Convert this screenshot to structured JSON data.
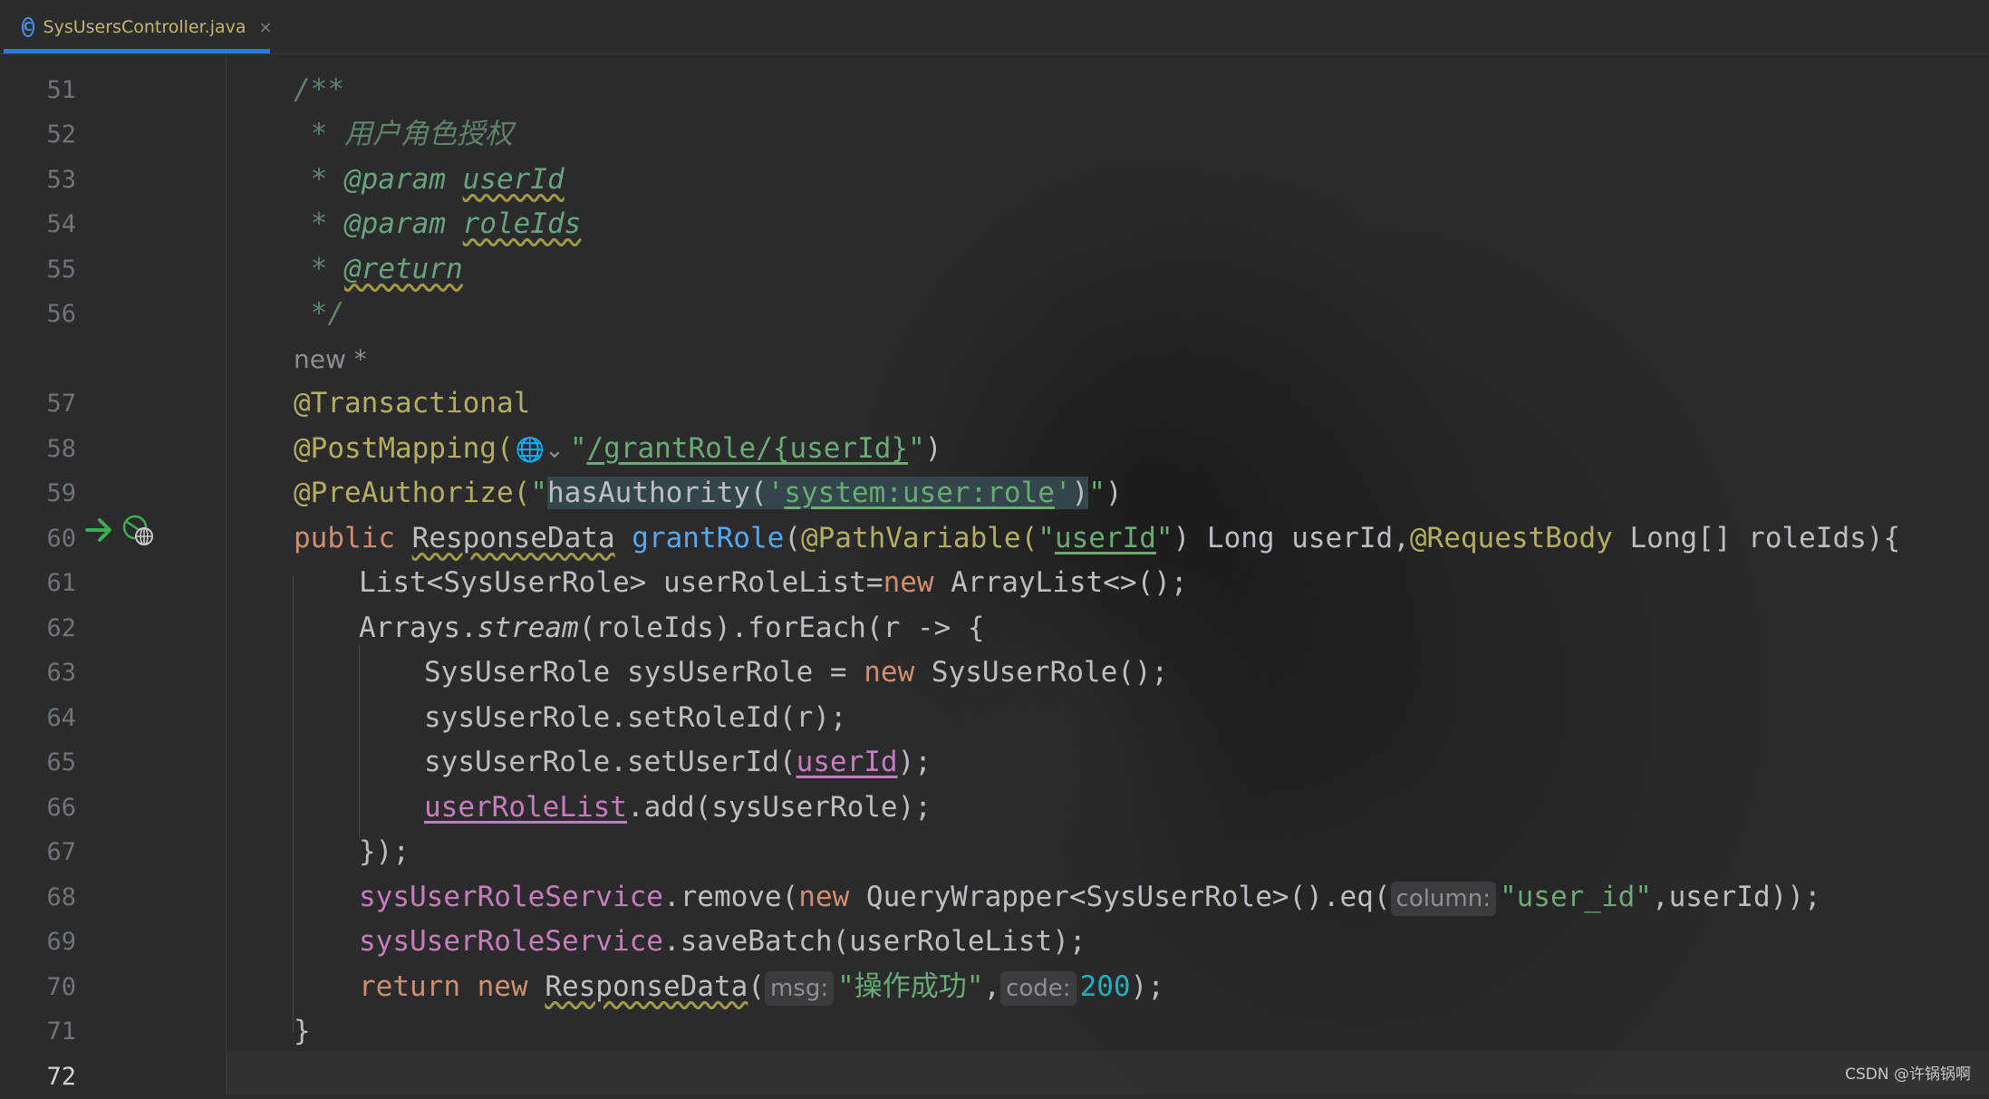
{
  "tab": {
    "icon": "class-c-icon",
    "icon_glyph": "C",
    "title": "SysUsersController.java",
    "close": "×"
  },
  "watermark": "CSDN @许锅锅啊",
  "lines": [
    {
      "n": "51"
    },
    {
      "n": "52"
    },
    {
      "n": "53"
    },
    {
      "n": "54"
    },
    {
      "n": "55"
    },
    {
      "n": "56"
    },
    {
      "n": ""
    },
    {
      "n": "57"
    },
    {
      "n": "58"
    },
    {
      "n": "59"
    },
    {
      "n": "60"
    },
    {
      "n": "61"
    },
    {
      "n": "62"
    },
    {
      "n": "63"
    },
    {
      "n": "64"
    },
    {
      "n": "65"
    },
    {
      "n": "66"
    },
    {
      "n": "67"
    },
    {
      "n": "68"
    },
    {
      "n": "69"
    },
    {
      "n": "70"
    },
    {
      "n": "71"
    },
    {
      "n": "72"
    }
  ],
  "code": {
    "l51": "/**",
    "l52_star": " * ",
    "l52_text": "用户角色授权",
    "l53_star": " * ",
    "l53_tag": "@param",
    "l53_name": "userId",
    "l54_star": " * ",
    "l54_tag": "@param",
    "l54_name": "roleIds",
    "l55_star": " * ",
    "l55_tag": "@return",
    "l56": " */",
    "hint_new": "new *",
    "l57": "@Transactional",
    "l58_anno": "@PostMapping(",
    "l58_q1": "\"",
    "l58_path": "/grantRole/{userId}",
    "l58_q2": "\"",
    "l58_end": ")",
    "l59_anno": "@PreAuthorize(",
    "l59_q1": "\"",
    "l59_expr1": "hasAuthority(",
    "l59_sq1": "'",
    "l59_perm": "system:user:role",
    "l59_sq2": "'",
    "l59_expr2": ")",
    "l59_q2": "\"",
    "l59_end": ")",
    "l60_public": "public ",
    "l60_type": "ResponseData",
    "l60_sp": " ",
    "l60_method": "grantRole",
    "l60_p1": "(",
    "l60_pv": "@PathVariable(",
    "l60_q1": "\"",
    "l60_var": "userId",
    "l60_q2": "\"",
    "l60_p2": ") Long userId,",
    "l60_rb": "@RequestBody",
    "l60_rest": " Long[] roleIds){",
    "l61_a": "List<SysUserRole> userRoleList=",
    "l61_new": "new",
    "l61_b": " ArrayList<>();",
    "l62_a": "Arrays.",
    "l62_stream": "stream",
    "l62_b": "(roleIds).forEach(r -> {",
    "l63_a": "SysUserRole sysUserRole = ",
    "l63_new": "new",
    "l63_b": " SysUserRole();",
    "l64": "sysUserRole.setRoleId(r);",
    "l65_a": "sysUserRole.setUserId(",
    "l65_var": "userId",
    "l65_b": ");",
    "l66_var": "userRoleList",
    "l66_b": ".add(sysUserRole);",
    "l67": "});",
    "l68_fld": "sysUserRoleService",
    "l68_a": ".remove(",
    "l68_new": "new",
    "l68_b": " QueryWrapper<SysUserRole>().eq(",
    "l68_hint": "column:",
    "l68_str": "\"user_id\"",
    "l68_c": ",userId));",
    "l69_fld": "sysUserRoleService",
    "l69_a": ".saveBatch(userRoleList);",
    "l70_ret": "return",
    "l70_new": " new ",
    "l70_type": "ResponseData",
    "l70_a": "(",
    "l70_hint1": "msg:",
    "l70_str": "\"操作成功\"",
    "l70_comma": ",",
    "l70_hint2": "code:",
    "l70_num": "200",
    "l70_b": ");",
    "l71": "}"
  },
  "colors": {
    "keyword": "#cf8e6d",
    "annotation": "#b3ae60",
    "string": "#6aab73",
    "field": "#c77dbb",
    "method": "#56a8f5",
    "number": "#2aacb8",
    "doc": "#5f826b",
    "text": "#bcbec4",
    "tab_accent": "#3574f0"
  },
  "gutter_icons": {
    "line_60": [
      "run-arrow-icon",
      "web-endpoint-icon"
    ]
  }
}
